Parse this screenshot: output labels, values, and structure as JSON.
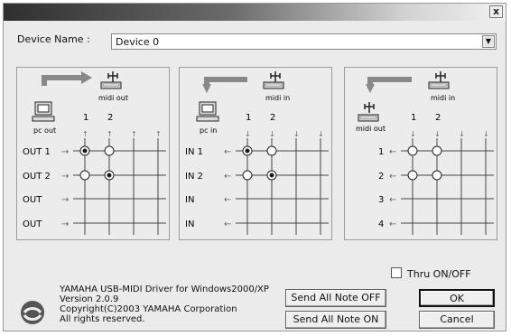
{
  "window": {
    "close_glyph": "x"
  },
  "device": {
    "label": "Device Name :",
    "value": "Device 0"
  },
  "icons": {
    "pc": "pc-icon",
    "usb": "usb-icon",
    "midi_port": "midi-port-icon"
  },
  "panels": [
    {
      "top_left": "pc out",
      "top_right": "midi out",
      "cols": [
        "1",
        "2"
      ],
      "row_labels": [
        "OUT 1",
        "OUT 2",
        "OUT",
        "OUT"
      ],
      "connections": [
        [
          1,
          0
        ],
        [
          0,
          1
        ]
      ]
    },
    {
      "top_left": "pc in",
      "top_right": "midi in",
      "cols": [
        "1",
        "2"
      ],
      "row_labels": [
        "IN 1",
        "IN 2",
        "IN",
        "IN"
      ],
      "connections": [
        [
          1,
          0
        ],
        [
          0,
          1
        ]
      ]
    },
    {
      "top_left": "midi out",
      "top_right": "midi in",
      "cols": [
        "1",
        "2"
      ],
      "row_labels": [
        "1",
        "2",
        "3",
        "4"
      ],
      "connections": [
        [
          0,
          0
        ],
        [
          0,
          0
        ]
      ]
    }
  ],
  "thru": {
    "label": "Thru ON/OFF",
    "checked": false
  },
  "info": {
    "line1": "YAMAHA USB-MIDI Driver for Windows2000/XP",
    "line2": "Version 2.0.9",
    "line3": "Copyright(C)2003 YAMAHA Corporation",
    "line4": "All rights reserved."
  },
  "buttons": {
    "send_note_off": "Send All Note OFF",
    "send_note_on": "Send All Note ON",
    "ok": "OK",
    "cancel": "Cancel"
  }
}
